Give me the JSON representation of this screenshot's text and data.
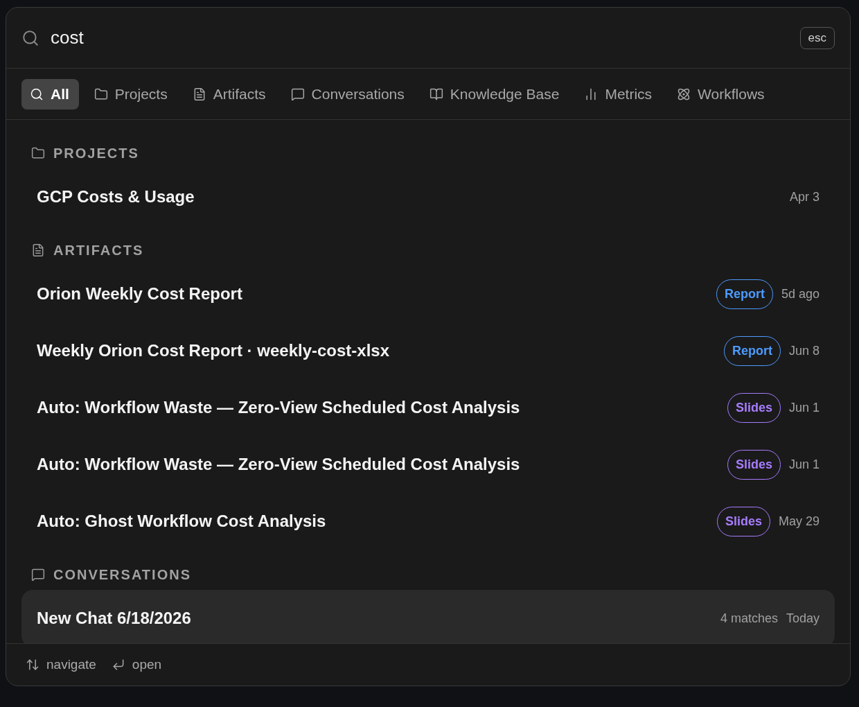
{
  "search": {
    "value": "cost",
    "esc_key": "esc"
  },
  "tabs": [
    {
      "label": "All",
      "kind": "all",
      "selected": true
    },
    {
      "label": "Projects",
      "kind": "projects",
      "selected": false
    },
    {
      "label": "Artifacts",
      "kind": "artifacts",
      "selected": false
    },
    {
      "label": "Conversations",
      "kind": "conversations",
      "selected": false
    },
    {
      "label": "Knowledge Base",
      "kind": "knowledge",
      "selected": false
    },
    {
      "label": "Metrics",
      "kind": "metrics",
      "selected": false
    },
    {
      "label": "Workflows",
      "kind": "workflows",
      "selected": false
    }
  ],
  "sections": [
    {
      "title": "PROJECTS",
      "kind": "projects",
      "items": [
        {
          "title": "GCP Costs & Usage",
          "date": "Apr 3",
          "selected": false
        }
      ]
    },
    {
      "title": "ARTIFACTS",
      "kind": "artifacts",
      "items": [
        {
          "title": "Orion Weekly Cost Report",
          "tag": {
            "label": "Report",
            "color": "#4d9bff"
          },
          "date": "5d ago",
          "selected": false
        },
        {
          "title": "Weekly Orion Cost Report · weekly-cost-xlsx",
          "tag": {
            "label": "Report",
            "color": "#4d9bff"
          },
          "date": "Jun 8",
          "selected": false
        },
        {
          "title": "Auto: Workflow Waste — Zero-View Scheduled Cost Analysis",
          "tag": {
            "label": "Slides",
            "color": "#a77cff"
          },
          "date": "Jun 1",
          "selected": false
        },
        {
          "title": "Auto: Workflow Waste — Zero-View Scheduled Cost Analysis",
          "tag": {
            "label": "Slides",
            "color": "#a77cff"
          },
          "date": "Jun 1",
          "selected": false
        },
        {
          "title": "Auto: Ghost Workflow Cost Analysis",
          "tag": {
            "label": "Slides",
            "color": "#a77cff"
          },
          "date": "May 29",
          "selected": false
        }
      ]
    },
    {
      "title": "CONVERSATIONS",
      "kind": "conversations",
      "items": [
        {
          "title": "New Chat 6/18/2026",
          "meta": "4 matches",
          "date": "Today",
          "selected": true
        }
      ]
    }
  ],
  "footer": [
    {
      "kind": "updown",
      "label": "navigate"
    },
    {
      "kind": "enter",
      "label": "open"
    }
  ]
}
